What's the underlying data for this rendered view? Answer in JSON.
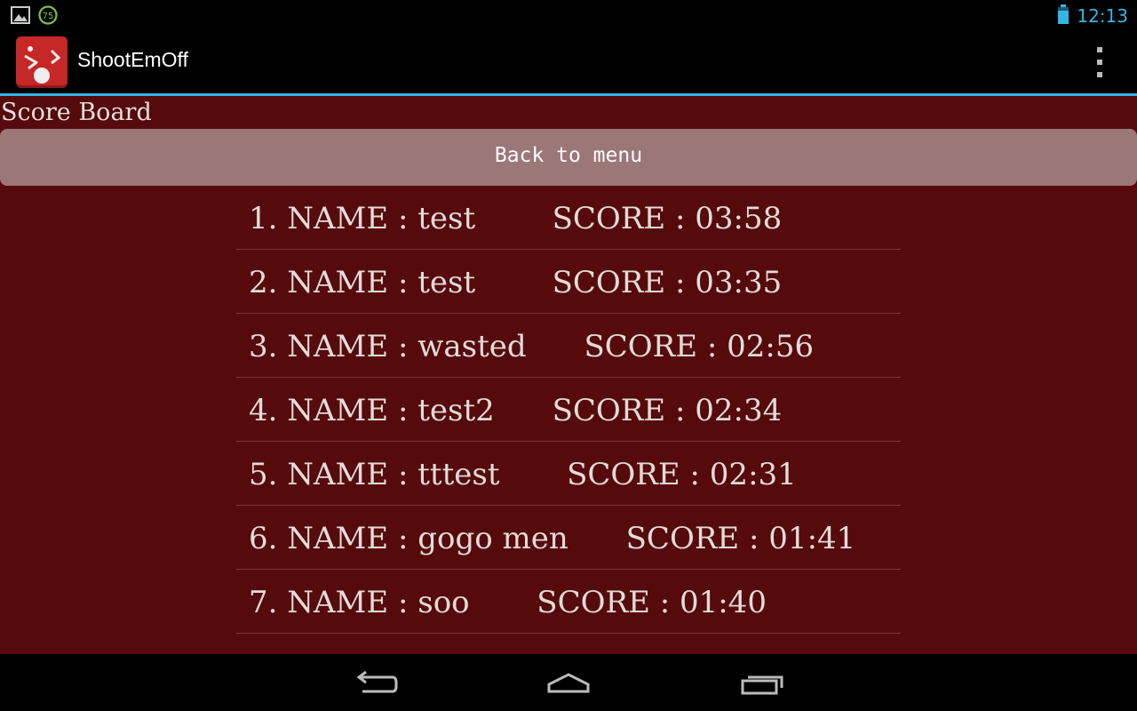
{
  "status_bar": {
    "notification_icons": [
      "image-icon",
      "download-75-icon"
    ],
    "notification_badge": "75",
    "battery_icon": "battery-icon",
    "time": "12:13"
  },
  "action_bar": {
    "app_title": "ShootEmOff",
    "app_icon": "app-icon",
    "overflow_icon": "overflow-menu-icon"
  },
  "page": {
    "title": "Score Board",
    "back_button_label": "Back to menu"
  },
  "scores": [
    {
      "text": "1. NAME : test        SCORE : 03:58"
    },
    {
      "text": "2. NAME : test        SCORE : 03:35"
    },
    {
      "text": "3. NAME : wasted      SCORE : 02:56"
    },
    {
      "text": "4. NAME : test2      SCORE : 02:34"
    },
    {
      "text": "5. NAME : tttest       SCORE : 02:31"
    },
    {
      "text": "6. NAME : gogo men      SCORE : 01:41"
    },
    {
      "text": "7. NAME : soo       SCORE : 01:40"
    }
  ],
  "nav_bar": {
    "back_icon": "back-icon",
    "home_icon": "home-icon",
    "recents_icon": "recent-apps-icon"
  },
  "colors": {
    "accent": "#33b5e5",
    "background": "#560a0c",
    "button": "#9c7778",
    "text": "#e2dcd8"
  }
}
